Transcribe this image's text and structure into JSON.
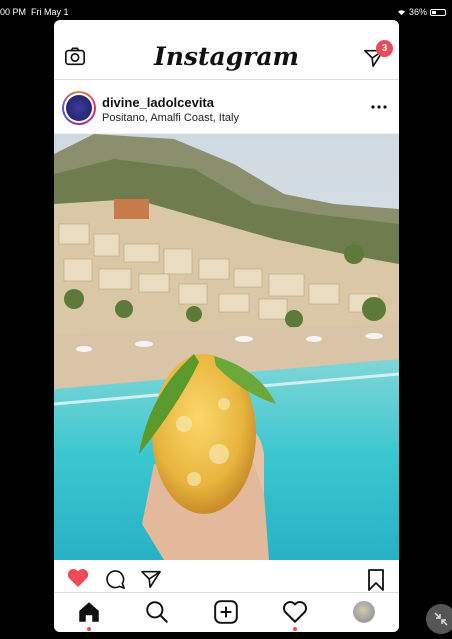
{
  "status_bar": {
    "time": "00 PM",
    "date": "Fri May 1",
    "battery": "36%"
  },
  "app": {
    "title": "Instagram",
    "dm_badge_count": "3"
  },
  "post": {
    "username": "divine_ladolcevita",
    "location": "Positano, Amalfi Coast, Italy",
    "liked": true
  },
  "tabs": [
    "home",
    "search",
    "new-post",
    "activity",
    "profile"
  ],
  "colors": {
    "badge": "#ed4956",
    "like": "#ed4956",
    "sea": "#39c6cf"
  }
}
